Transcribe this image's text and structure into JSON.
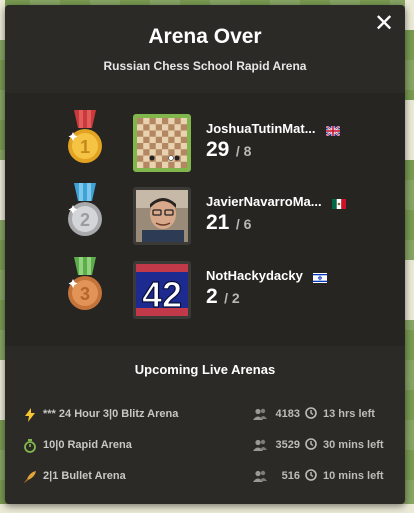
{
  "modal": {
    "title": "Arena Over",
    "subtitle": "Russian Chess School Rapid Arena",
    "close_symbol": "✕"
  },
  "podium": [
    {
      "rank": "1",
      "medal": "gold-medal-icon",
      "name": "JoshuaTutinMat...",
      "flag": "uk-flag-icon",
      "score": "29",
      "games": "/ 8",
      "avatar": "chessboard-avatar"
    },
    {
      "rank": "2",
      "medal": "silver-medal-icon",
      "name": "JavierNavarroMa...",
      "flag": "mexico-flag-icon",
      "score": "21",
      "games": "/ 6",
      "avatar": "photo-avatar"
    },
    {
      "rank": "3",
      "medal": "bronze-medal-icon",
      "name": "NotHackydacky",
      "flag": "israel-flag-icon",
      "score": "2",
      "games": "/ 2",
      "avatar": "number-42-avatar",
      "avatar_text": "42"
    }
  ],
  "upcoming": {
    "title": "Upcoming Live Arenas",
    "arenas": [
      {
        "name": "*** 24 Hour 3|0 Blitz Arena",
        "icon": "blitz-lightning-icon",
        "icon_color": "#f7c631",
        "players": "4183",
        "time": "13 hrs left"
      },
      {
        "name": "10|0 Rapid Arena",
        "icon": "rapid-timer-icon",
        "icon_color": "#81b64c",
        "players": "3529",
        "time": "30 mins left"
      },
      {
        "name": "2|1 Bullet Arena",
        "icon": "bullet-icon",
        "icon_color": "#e0a43a",
        "players": "516",
        "time": "10 mins left"
      }
    ]
  },
  "colors": {
    "modal_bg": "#2b2a27",
    "podium_bg": "#262522",
    "winner_border": "#81b64c",
    "background_green": "#7a9b52"
  }
}
